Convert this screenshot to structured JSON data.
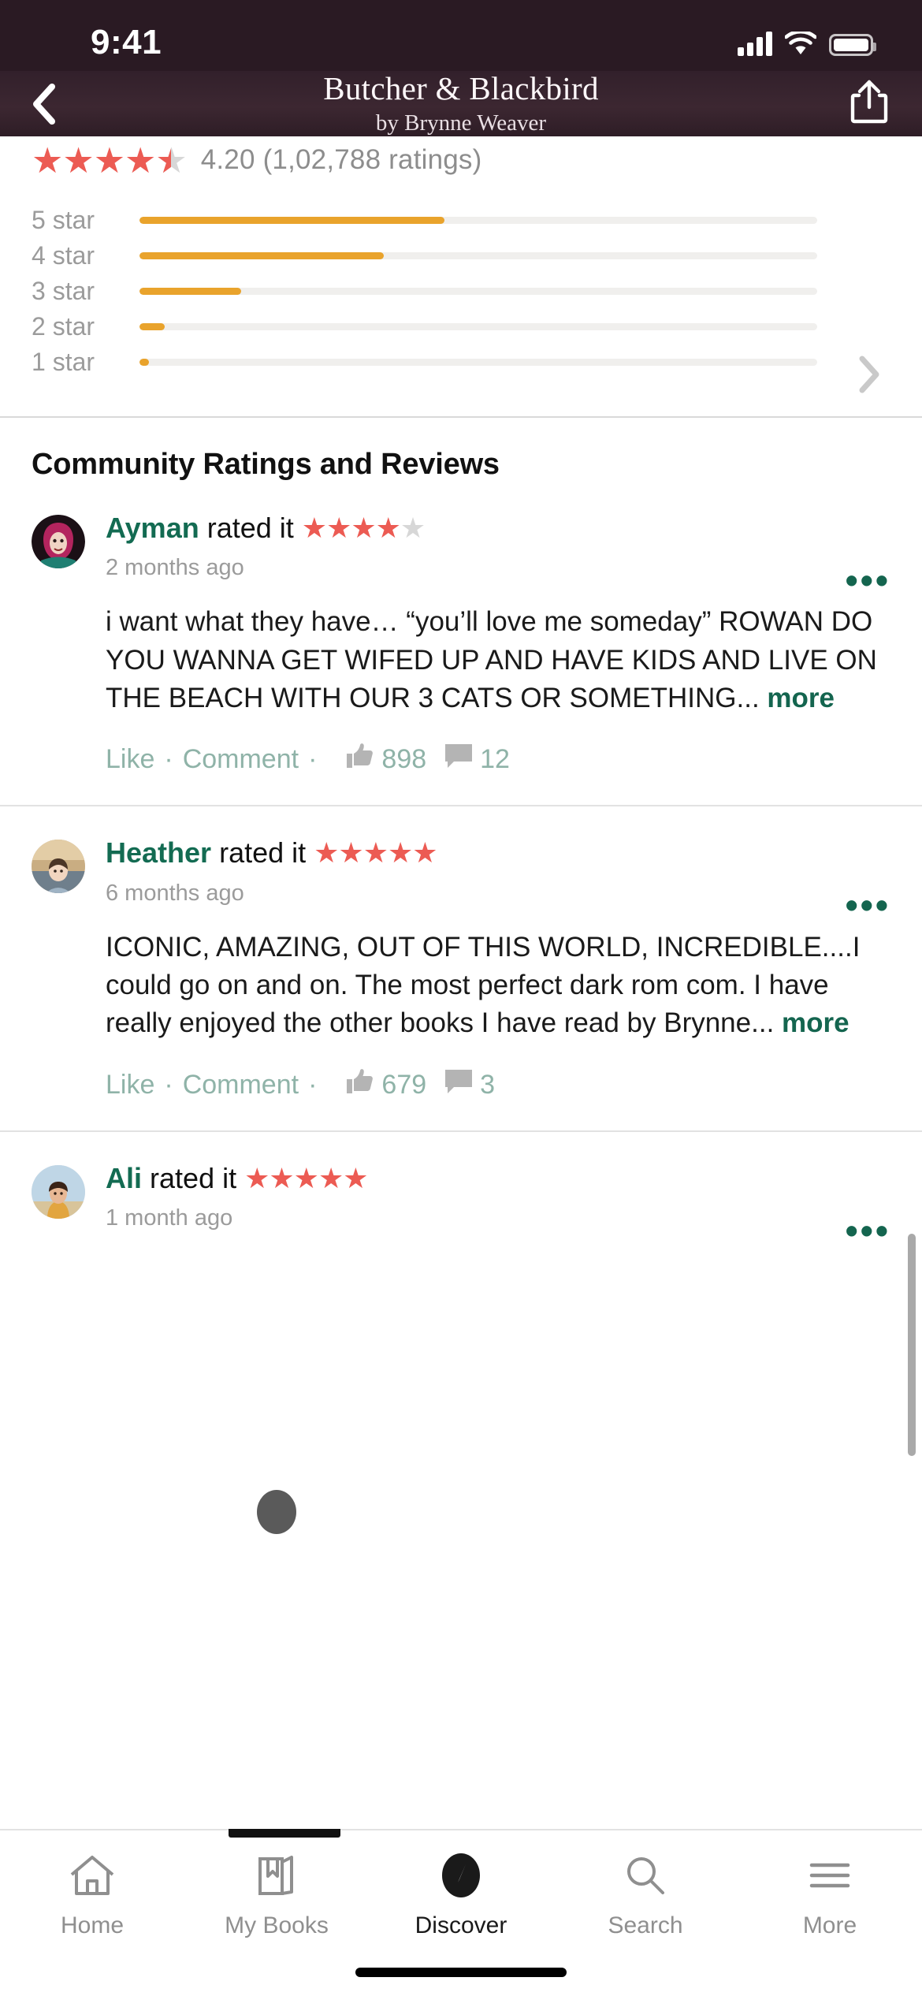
{
  "status_bar": {
    "time": "9:41",
    "icons": [
      "cellular-signal-icon",
      "wifi-icon",
      "battery-icon"
    ]
  },
  "header": {
    "back_icon": "chevron-left-icon",
    "title": "Butcher & Blackbird",
    "subtitle": "by Brynne Weaver",
    "share_icon": "share-icon"
  },
  "ratings": {
    "average": "4.20",
    "ratings_count_text": "(1,02,788 ratings)",
    "summary_line": "4.20 (1,02,788 ratings)",
    "stars_filled": 4,
    "stars_half": 1,
    "chevron_icon": "chevron-right-icon",
    "star_color": "#ec5b53",
    "bar_color": "#e9a32c",
    "track_color": "#f0efed"
  },
  "chart_data": {
    "type": "bar",
    "title": "Rating distribution",
    "orientation": "horizontal",
    "categories": [
      "5 star",
      "4 star",
      "3 star",
      "2 star",
      "1 star"
    ],
    "values": [
      45,
      36,
      15,
      3.7,
      1.4
    ],
    "unit": "percent",
    "xlim": [
      0,
      100
    ],
    "xlabel": "",
    "ylabel": "",
    "grid": false,
    "legend": "none"
  },
  "section": {
    "title": "Community Ratings and Reviews"
  },
  "reviews": [
    {
      "name": "Ayman",
      "rated_text": "rated it",
      "stars_filled": 4,
      "stars_empty": 1,
      "time": "2 months ago",
      "avatar": "avatar-ayman",
      "body": "i want what they have…  “you’ll love me someday” ROWAN DO YOU WANNA GET WIFED UP AND HAVE KIDS AND LIVE ON THE BEACH WITH OUR 3 CATS OR SOMETHING...",
      "more_label": "more",
      "like_label": "Like",
      "comment_label": "Comment",
      "likes": "898",
      "comments": "12",
      "menu_icon": "overflow-menu-icon"
    },
    {
      "name": "Heather",
      "rated_text": "rated it",
      "stars_filled": 5,
      "stars_empty": 0,
      "time": "6 months ago",
      "avatar": "avatar-heather",
      "body": "ICONIC, AMAZING, OUT OF THIS WORLD, INCREDIBLE....I could go on and on. The most perfect dark rom com. I have really enjoyed the other books I have read by Brynne...",
      "more_label": "more",
      "like_label": "Like",
      "comment_label": "Comment",
      "likes": "679",
      "comments": "3",
      "menu_icon": "overflow-menu-icon"
    },
    {
      "name": "Ali",
      "rated_text": "rated it",
      "stars_filled": 5,
      "stars_empty": 0,
      "time": "1 month ago",
      "avatar": "avatar-ali",
      "body": "",
      "more_label": "",
      "like_label": "",
      "comment_label": "",
      "likes": "",
      "comments": "",
      "menu_icon": "overflow-menu-icon"
    }
  ],
  "tab_bar": {
    "active": "Discover",
    "items": [
      {
        "label": "Home",
        "icon": "home-icon"
      },
      {
        "label": "My Books",
        "icon": "books-icon"
      },
      {
        "label": "Discover",
        "icon": "compass-icon"
      },
      {
        "label": "Search",
        "icon": "search-icon"
      },
      {
        "label": "More",
        "icon": "hamburger-menu-icon"
      }
    ]
  }
}
